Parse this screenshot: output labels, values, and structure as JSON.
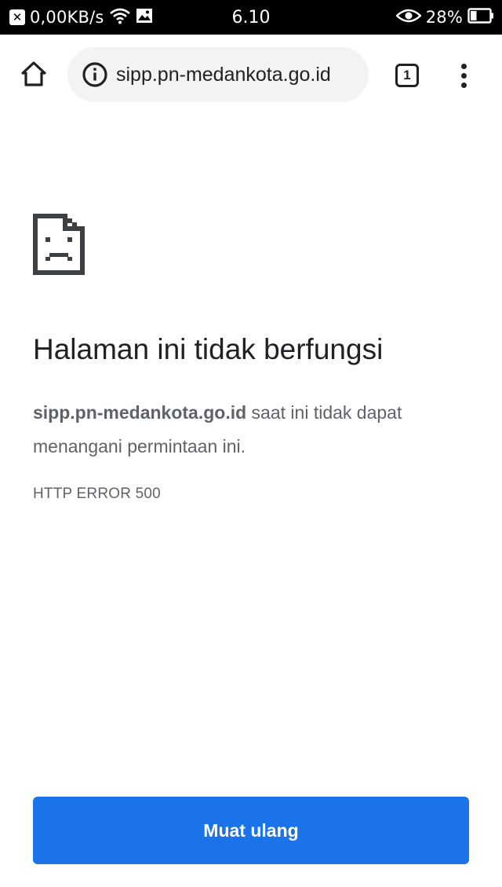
{
  "status_bar": {
    "speed": "0,00KB/s",
    "time": "6.10",
    "battery": "28%"
  },
  "toolbar": {
    "url": "sipp.pn-medankota.go.id",
    "tab_count": "1"
  },
  "error_page": {
    "title": "Halaman ini tidak berfungsi",
    "host": "sipp.pn-medankota.go.id",
    "message": " saat ini tidak dapat menangani permintaan ini.",
    "error_code": "HTTP ERROR 500",
    "reload_label": "Muat ulang"
  },
  "colors": {
    "accent": "#1a73e8",
    "text_primary": "#202124",
    "text_secondary": "#5f6368",
    "urlbar_bg": "#f1f3f4"
  },
  "icons": [
    "close-notification-icon",
    "wifi-icon",
    "image-icon",
    "eye-icon",
    "battery-icon",
    "home-icon",
    "info-icon",
    "tabs-icon",
    "more-vert-icon",
    "sad-page-icon"
  ]
}
